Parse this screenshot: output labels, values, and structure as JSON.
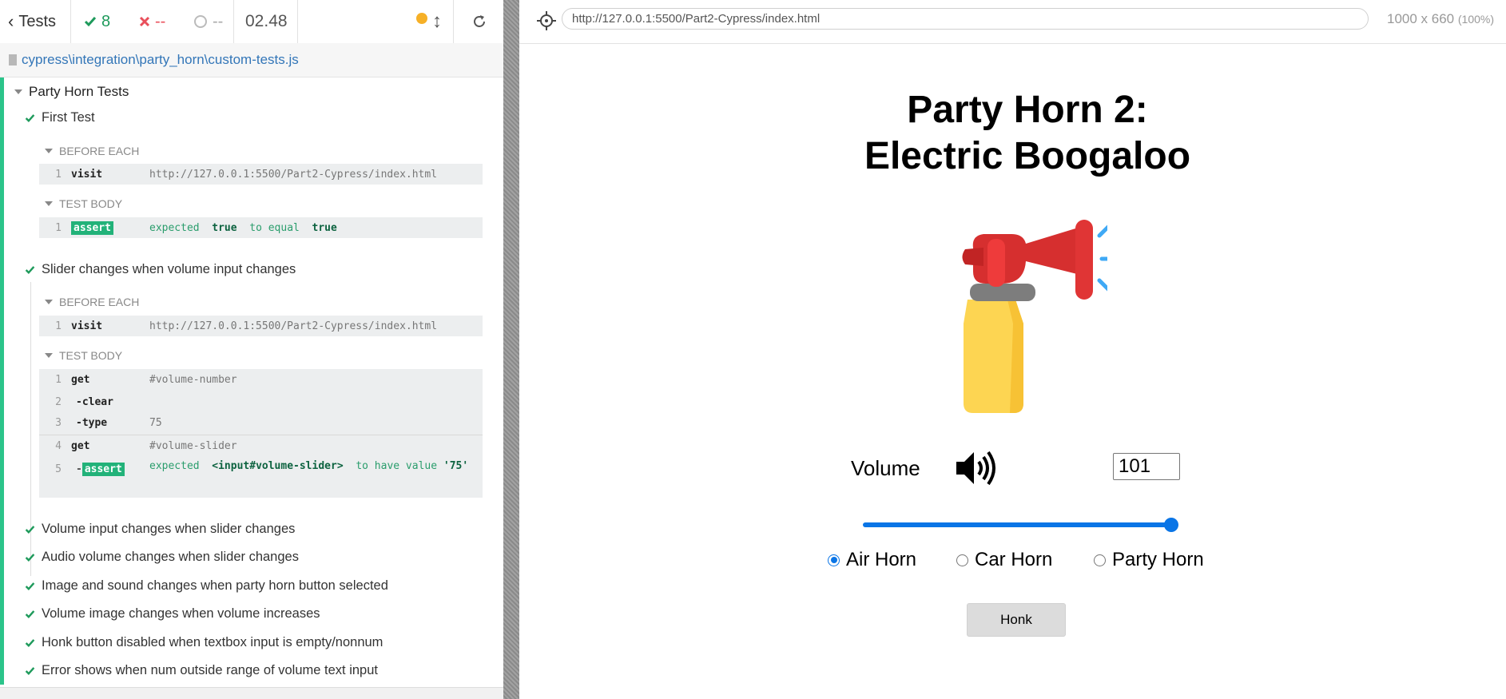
{
  "reporter": {
    "tests_label": "Tests",
    "passed": "8",
    "failed": "--",
    "pending": "--",
    "duration": "02.48",
    "spec_path": "cypress\\integration\\party_horn\\custom-tests.js",
    "suite_title": "Party Horn Tests",
    "tests": [
      {
        "title": "First Test",
        "before_each_label": "BEFORE EACH",
        "before_each": [
          {
            "num": "1",
            "name": "visit",
            "msg": "http://127.0.0.1:5500/Part2-Cypress/index.html"
          }
        ],
        "body_label": "TEST BODY",
        "body": [
          {
            "num": "1",
            "name": "assert",
            "msg_a": "expected",
            "val1": "true",
            "msg_b": "to equal",
            "val2": "true"
          }
        ]
      },
      {
        "title": "Slider changes when volume input changes",
        "before_each_label": "BEFORE EACH",
        "before_each": [
          {
            "num": "1",
            "name": "visit",
            "msg": "http://127.0.0.1:5500/Part2-Cypress/index.html"
          }
        ],
        "body_label": "TEST BODY",
        "body": [
          {
            "num": "1",
            "name": "get",
            "msg": "#volume-number"
          },
          {
            "num": "2",
            "name": "-clear",
            "msg": ""
          },
          {
            "num": "3",
            "name": "-type",
            "msg": "75"
          },
          {
            "num": "4",
            "name": "get",
            "msg": "#volume-slider"
          },
          {
            "num": "5",
            "name": "assert",
            "msg_a": "expected",
            "val1": "<input#volume-slider>",
            "msg_b": "to have value",
            "val2": "'75'"
          }
        ]
      },
      {
        "title": "Volume input changes when slider changes"
      },
      {
        "title": "Audio volume changes when slider changes"
      },
      {
        "title": "Image and sound changes when party horn button selected"
      },
      {
        "title": "Volume image changes when volume increases"
      },
      {
        "title": "Honk button disabled when textbox input is empty/nonnum"
      },
      {
        "title": "Error shows when num outside range of volume text input"
      }
    ]
  },
  "aut": {
    "url": "http://127.0.0.1:5500/Part2-Cypress/index.html",
    "viewport": "1000 x 660",
    "zoom": "(100%)"
  },
  "app": {
    "title_line1": "Party Horn 2:",
    "title_line2": "Electric Boogaloo",
    "volume_label": "Volume",
    "volume_value": "101",
    "slider_level_fraction": 1.0,
    "radios": [
      {
        "label": "Air Horn",
        "checked": true
      },
      {
        "label": "Car Horn",
        "checked": false
      },
      {
        "label": "Party Horn",
        "checked": false
      }
    ],
    "honk_label": "Honk"
  },
  "colors": {
    "pass": "#1e9a5b",
    "fail": "#e94f5b",
    "accent": "#0a75e6",
    "suite_bar": "#2bc48a"
  },
  "icons": [
    "chevron-left-icon",
    "check-icon",
    "x-icon",
    "circle-icon",
    "running-dot-icon",
    "scroll-toggle-icon",
    "reload-icon",
    "crosshair-icon",
    "file-icon",
    "caret-down-icon",
    "air-horn-image",
    "volume-high-icon"
  ]
}
